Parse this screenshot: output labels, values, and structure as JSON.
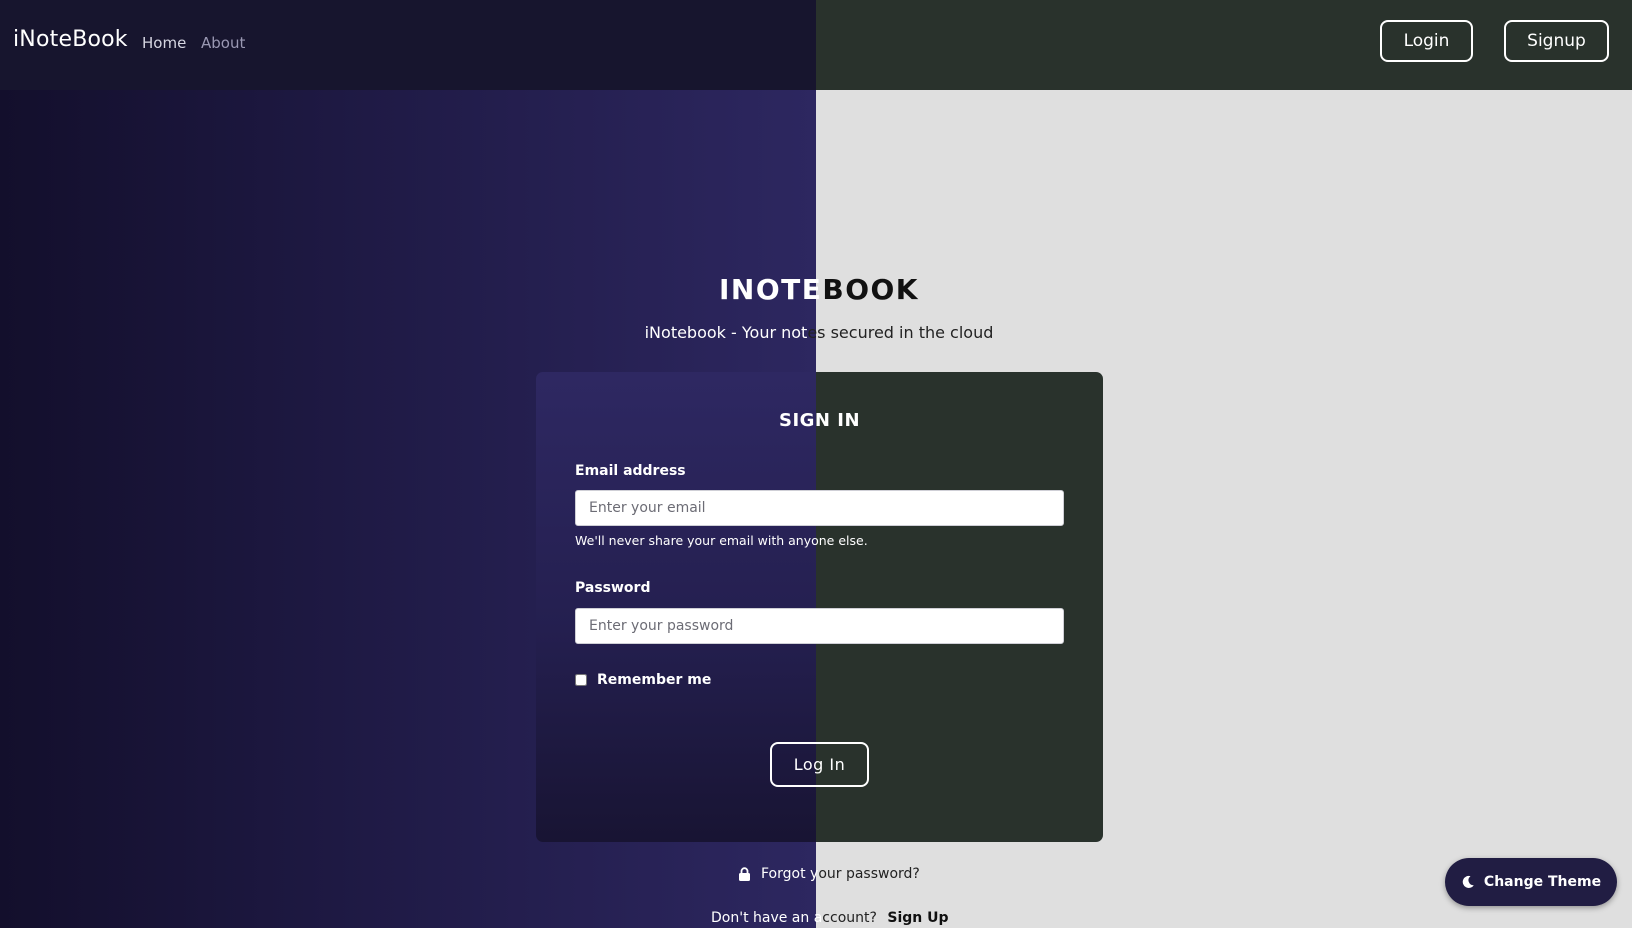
{
  "navbar": {
    "brand": "iNoteBook",
    "links": {
      "home": "Home",
      "about": "About"
    },
    "login_label": "Login",
    "signup_label": "Signup"
  },
  "hero": {
    "title_left": "INOTE",
    "title_right": "BOOK",
    "subtitle_left": "iNotebook - Your not",
    "subtitle_right": "es secured in the cloud"
  },
  "form": {
    "title": "SIGN IN",
    "email_label": "Email address",
    "email_placeholder": "Enter your email",
    "email_help": "We'll never share your email with anyone else.",
    "password_label": "Password",
    "password_placeholder": "Enter your password",
    "remember_label": "Remember me",
    "submit_label": "Log In"
  },
  "footer": {
    "forgot_left": "Forgot y",
    "forgot_right": "our password?",
    "no_account_left": "Don't have an a",
    "no_account_right": "ccount?",
    "signup_link": "Sign Up"
  },
  "theme_button": {
    "label": "Change Theme",
    "icon": "moon-icon"
  },
  "colors": {
    "left_bg": "#1f1a45",
    "right_bg": "#dfdfdf",
    "nav_left": "#17152e",
    "nav_right": "#29322c",
    "card_right": "#29322c",
    "theme_button": "#211d43"
  }
}
